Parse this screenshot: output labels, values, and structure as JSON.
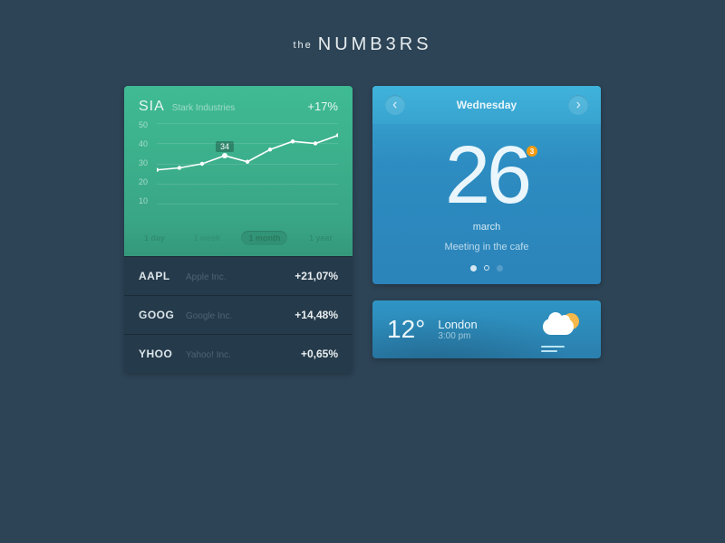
{
  "title_prefix": "the",
  "title_main": "NUMB3RS",
  "stocks": {
    "featured": {
      "symbol": "SIA",
      "name": "Stark Industries",
      "change": "+17%"
    },
    "chart_label_value": "34",
    "ranges": [
      "1 day",
      "1 week",
      "1 month",
      "1 year"
    ],
    "range_active_index": 2,
    "list": [
      {
        "symbol": "AAPL",
        "name": "Apple Inc.",
        "change": "+21,07%"
      },
      {
        "symbol": "GOOG",
        "name": "Google Inc.",
        "change": "+14,48%"
      },
      {
        "symbol": "YHOO",
        "name": "Yahoo! Inc.",
        "change": "+0,65%"
      }
    ]
  },
  "calendar": {
    "weekday": "Wednesday",
    "date": "26",
    "month": "march",
    "event": "Meeting in the cafe",
    "notif_count": "3"
  },
  "weather": {
    "temp": "12°",
    "city": "London",
    "time": "3:00 pm"
  },
  "chart_data": {
    "type": "line",
    "title": "SIA",
    "ylabel": "",
    "ylim": [
      10,
      50
    ],
    "yticks": [
      50,
      40,
      30,
      20,
      10
    ],
    "x": [
      0,
      1,
      2,
      3,
      4,
      5,
      6,
      7,
      8
    ],
    "values": [
      27,
      28,
      30,
      34,
      31,
      37,
      41,
      40,
      44
    ],
    "highlight_index": 3,
    "highlight_value": 34
  }
}
